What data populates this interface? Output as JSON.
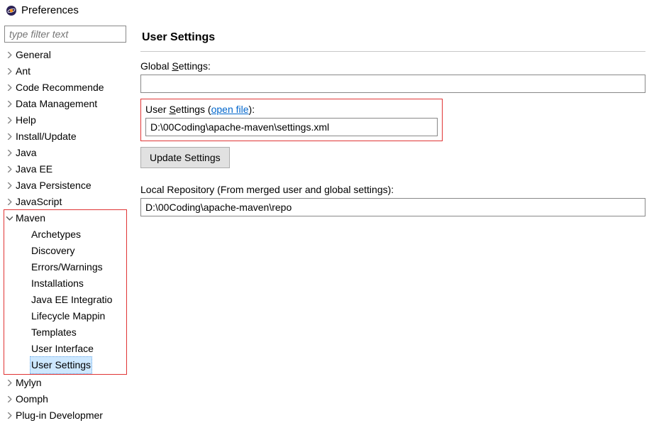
{
  "window": {
    "title": "Preferences"
  },
  "sidebar": {
    "filter_placeholder": "type filter text",
    "items": [
      {
        "label": "General",
        "expandable": true
      },
      {
        "label": "Ant",
        "expandable": true
      },
      {
        "label": "Code Recommende",
        "expandable": true
      },
      {
        "label": "Data Management",
        "expandable": true
      },
      {
        "label": "Help",
        "expandable": true
      },
      {
        "label": "Install/Update",
        "expandable": true
      },
      {
        "label": "Java",
        "expandable": true
      },
      {
        "label": "Java EE",
        "expandable": true
      },
      {
        "label": "Java Persistence",
        "expandable": true
      },
      {
        "label": "JavaScript",
        "expandable": true
      },
      {
        "label": "Maven",
        "expandable": true,
        "expanded": true,
        "highlighted": true,
        "children": [
          {
            "label": "Archetypes"
          },
          {
            "label": "Discovery"
          },
          {
            "label": "Errors/Warnings"
          },
          {
            "label": "Installations"
          },
          {
            "label": "Java EE Integratio"
          },
          {
            "label": "Lifecycle Mappin"
          },
          {
            "label": "Templates"
          },
          {
            "label": "User Interface"
          },
          {
            "label": "User Settings",
            "selected": true
          }
        ]
      },
      {
        "label": "Mylyn",
        "expandable": true
      },
      {
        "label": "Oomph",
        "expandable": true
      },
      {
        "label": "Plug-in Developmer",
        "expandable": true
      }
    ]
  },
  "main": {
    "heading": "User Settings",
    "global_settings_label_pre": "Global ",
    "global_settings_label_mnemonic": "S",
    "global_settings_label_post": "ettings:",
    "global_settings_value": "",
    "user_settings_label_pre": "User ",
    "user_settings_label_mnemonic": "S",
    "user_settings_label_mid": "ettings (",
    "user_settings_link": "open file",
    "user_settings_label_end": "):",
    "user_settings_value": "D:\\00Coding\\apache-maven\\settings.xml",
    "update_button": "Update Settings",
    "local_repo_label": "Local Repository (From merged user and global settings):",
    "local_repo_value": "D:\\00Coding\\apache-maven\\repo"
  }
}
